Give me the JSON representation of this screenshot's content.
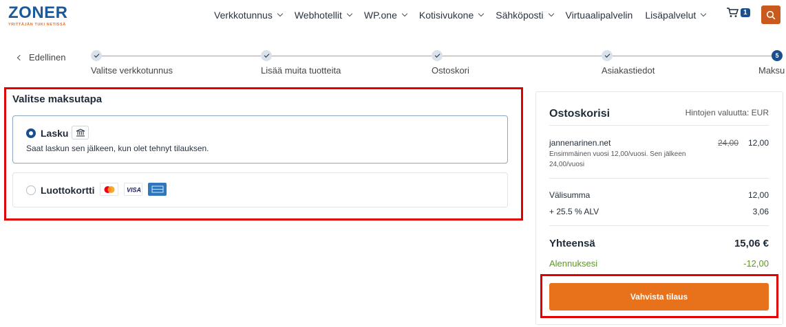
{
  "logo": {
    "name": "ZONER",
    "tagline": "YRITTÄJÄN TUKI NETISSÄ"
  },
  "nav": {
    "items": [
      {
        "label": "Verkkotunnus",
        "dropdown": true
      },
      {
        "label": "Webhotellit",
        "dropdown": true
      },
      {
        "label": "WP.one",
        "dropdown": true
      },
      {
        "label": "Kotisivukone",
        "dropdown": true
      },
      {
        "label": "Sähköposti",
        "dropdown": true
      },
      {
        "label": "Virtuaalipalvelin",
        "dropdown": false
      },
      {
        "label": "Lisäpalvelut",
        "dropdown": true
      }
    ],
    "cart_count": "1"
  },
  "stepper": {
    "back_label": "Edellinen",
    "steps": [
      {
        "label": "Valitse verkkotunnus",
        "status": "done"
      },
      {
        "label": "Lisää muita tuotteita",
        "status": "done"
      },
      {
        "label": "Ostoskori",
        "status": "done"
      },
      {
        "label": "Asiakastiedot",
        "status": "done"
      },
      {
        "label": "Maksu",
        "status": "active",
        "number": "5"
      }
    ]
  },
  "payment": {
    "title": "Valitse maksutapa",
    "options": [
      {
        "label": "Lasku",
        "selected": true,
        "description": "Saat laskun sen jälkeen, kun olet tehnyt tilauksen."
      },
      {
        "label": "Luottokortti",
        "selected": false,
        "cards": [
          "mastercard-icon",
          "visa-icon",
          "amex-icon"
        ]
      }
    ]
  },
  "cart": {
    "title": "Ostoskorisi",
    "currency_note": "Hintojen valuutta: EUR",
    "item": {
      "name": "jannenarinen.net",
      "note": "Ensimmäinen vuosi 12,00/vuosi. Sen jälkeen 24,00/vuosi",
      "old_price": "24,00",
      "price": "12,00"
    },
    "subtotal_label": "Välisumma",
    "subtotal": "12,00",
    "vat_label": "+ 25.5 % ALV",
    "vat": "3,06",
    "total_label": "Yhteensä",
    "total": "15,06 €",
    "discount_label": "Alennuksesi",
    "discount": "-12,00",
    "confirm_label": "Vahvista tilaus"
  },
  "colors": {
    "brand_blue": "#1a4f8f",
    "accent_orange": "#e8711c",
    "discount_green": "#5a9a1a",
    "highlight_red": "#e00000"
  }
}
